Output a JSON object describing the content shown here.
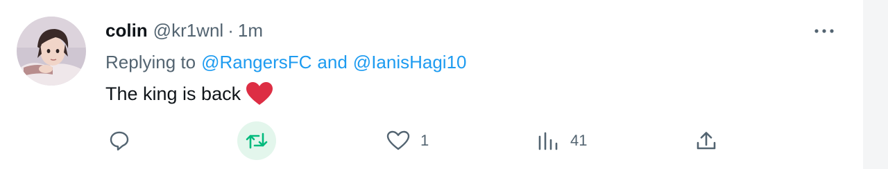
{
  "tweet": {
    "display_name": "colin",
    "handle": "@kr1wnl",
    "separator": "·",
    "time": "1m",
    "replying_prefix": "Replying to",
    "reply_to_1": "@RangersFC",
    "reply_conjunction": "and",
    "reply_to_2": "@IanisHagi10",
    "text": "The king is back",
    "text_emoji": "red-heart-emoji"
  },
  "actions": {
    "reply_icon": "speech-bubble-icon",
    "retweet_icon": "retweet-arrows-icon",
    "retweet_hover_bg": "#e3f6ec",
    "retweet_color": "#00ba7c",
    "like_icon": "heart-outline-icon",
    "like_count": "1",
    "views_icon": "bar-chart-icon",
    "views_count": "41",
    "share_icon": "share-upload-icon",
    "more_icon": "more-dots-icon"
  },
  "colors": {
    "text_primary": "#0f1419",
    "text_secondary": "#536471",
    "link": "#1d9bf0",
    "heart": "#e0245e"
  }
}
